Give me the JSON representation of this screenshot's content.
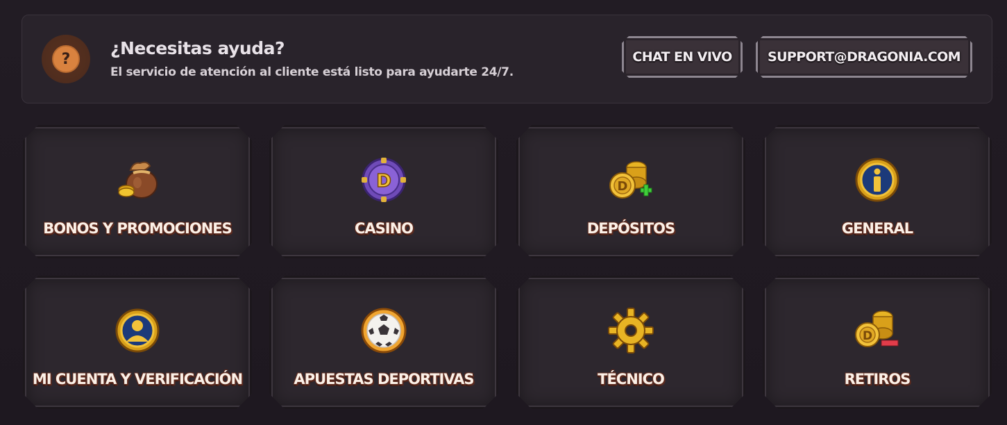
{
  "help": {
    "icon": "question-icon",
    "icon_glyph": "?",
    "title": "¿Necesitas ayuda?",
    "subtitle": "El servicio de atención al cliente está listo para ayudarte 24/7.",
    "chat_label": "CHAT EN VIVO",
    "email_label": "SUPPORT@DRAGONIA.COM"
  },
  "categories": [
    {
      "label": "BONOS Y PROMOCIONES",
      "icon": "money-bag-icon"
    },
    {
      "label": "CASINO",
      "icon": "casino-chip-icon"
    },
    {
      "label": "DEPÓSITOS",
      "icon": "coins-plus-icon"
    },
    {
      "label": "GENERAL",
      "icon": "info-icon"
    },
    {
      "label": "MI CUENTA Y VERIFICACIÓN",
      "icon": "user-avatar-icon"
    },
    {
      "label": "APUESTAS DEPORTIVAS",
      "icon": "soccer-ball-icon"
    },
    {
      "label": "TÉCNICO",
      "icon": "gear-icon"
    },
    {
      "label": "RETIROS",
      "icon": "coins-minus-icon"
    }
  ],
  "colors": {
    "accent_orange": "#d9823f",
    "gold": "#e6b422",
    "card_bg": "#2d272e",
    "label_shadow": "#5c2a1e"
  }
}
